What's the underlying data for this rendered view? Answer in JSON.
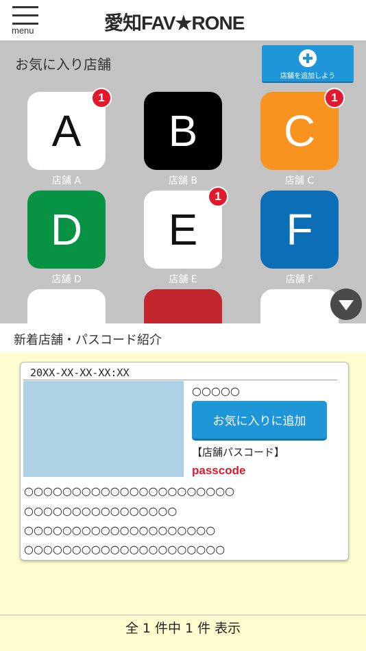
{
  "header": {
    "menu_label": "menu",
    "logo_text": "愛知FAV★RONE"
  },
  "favorites": {
    "title": "お気に入り店舗",
    "add_button_label": "店舗を追加しよう",
    "stores": [
      {
        "letter": "A",
        "name": "店舗 A",
        "badge": "1",
        "bg": "#ffffff",
        "fg": "#111111"
      },
      {
        "letter": "B",
        "name": "店舗 B",
        "badge": "",
        "bg": "#000000",
        "fg": "#ffffff"
      },
      {
        "letter": "C",
        "name": "店舗 C",
        "badge": "1",
        "bg": "#f7931e",
        "fg": "#ffffff"
      },
      {
        "letter": "D",
        "name": "店舗 D",
        "badge": "",
        "bg": "#079244",
        "fg": "#ffffff"
      },
      {
        "letter": "E",
        "name": "店舗 E",
        "badge": "1",
        "bg": "#ffffff",
        "fg": "#111111"
      },
      {
        "letter": "F",
        "name": "店舗 F",
        "badge": "",
        "bg": "#0b6eb7",
        "fg": "#ffffff"
      },
      {
        "letter": "",
        "name": "",
        "badge": "",
        "bg": "#ffffff",
        "fg": "#111111"
      },
      {
        "letter": "",
        "name": "",
        "badge": "",
        "bg": "#c1272d",
        "fg": "#ffffff"
      },
      {
        "letter": "",
        "name": "",
        "badge": "",
        "bg": "#ffffff",
        "fg": "#111111"
      }
    ]
  },
  "new_stores": {
    "title": "新着店舗・パスコード紹介",
    "card": {
      "date": "20XX-XX-XX-XX:XX",
      "store_name": "○○○○○",
      "favorite_button": "お気に入りに追加",
      "passcode_label": "【店舗パスコード】",
      "passcode": "passcode",
      "description_lines": [
        "○○○○○○○○○○○○○○○○○○○○○○",
        "○○○○○○○○○○○○○○○○",
        "○○○○○○○○○○○○○○○○○○○○",
        "○○○○○○○○○○○○○○○○○○○○○"
      ]
    }
  },
  "footer": {
    "count_text": "全 1 件中 1 件 表示"
  },
  "colors": {
    "accent": "#1f96d7",
    "badge": "#e1192d",
    "favorites_bg": "#c3c3c3",
    "new_area_bg": "#fffdd0"
  }
}
